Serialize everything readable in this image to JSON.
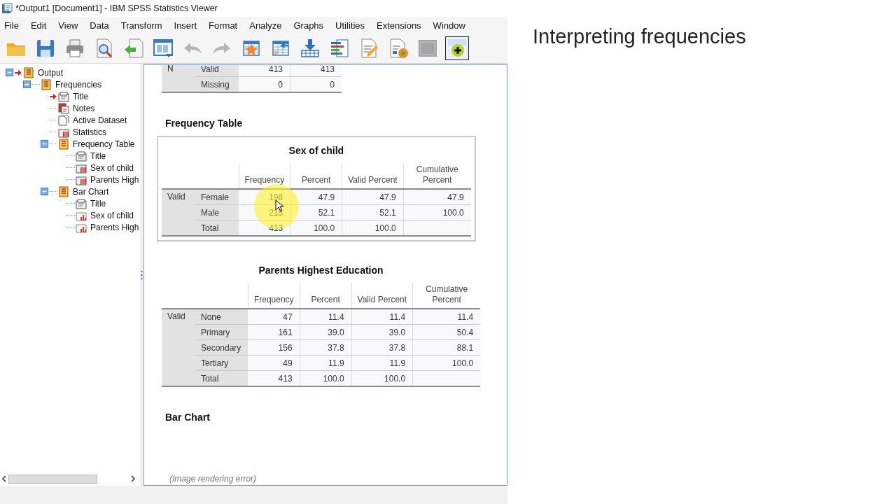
{
  "window": {
    "title": "*Output1 [Document1] - IBM SPSS Statistics Viewer"
  },
  "menu": [
    "File",
    "Edit",
    "View",
    "Data",
    "Transform",
    "Insert",
    "Format",
    "Analyze",
    "Graphs",
    "Utilities",
    "Extensions",
    "Window"
  ],
  "toolbar": [
    {
      "kind": "folder",
      "disabled": false,
      "pressed": false
    },
    {
      "kind": "floppy",
      "disabled": false,
      "pressed": false
    },
    {
      "kind": "printer",
      "disabled": false,
      "pressed": false
    },
    {
      "kind": "preview",
      "disabled": false,
      "pressed": false
    },
    {
      "kind": "export",
      "disabled": false,
      "pressed": false
    },
    {
      "kind": "dialog",
      "disabled": false,
      "pressed": false
    },
    {
      "kind": "undo",
      "disabled": true,
      "pressed": false
    },
    {
      "kind": "redo",
      "disabled": true,
      "pressed": false
    },
    {
      "kind": "table-star",
      "disabled": false,
      "pressed": false
    },
    {
      "kind": "table-arrow",
      "disabled": false,
      "pressed": false
    },
    {
      "kind": "download",
      "disabled": false,
      "pressed": false
    },
    {
      "kind": "bars",
      "disabled": false,
      "pressed": false
    },
    {
      "kind": "doc-pencil",
      "disabled": false,
      "pressed": false
    },
    {
      "kind": "doc-play",
      "disabled": false,
      "pressed": false
    },
    {
      "kind": "panel",
      "disabled": true,
      "pressed": false
    },
    {
      "kind": "plus",
      "disabled": false,
      "pressed": true
    }
  ],
  "outline": [
    {
      "label": "Output",
      "kind": "folder",
      "expanded": true,
      "current": true,
      "children": [
        {
          "label": "Frequencies",
          "kind": "folder",
          "expanded": true,
          "current": false,
          "children": [
            {
              "label": "Title",
              "kind": "title",
              "current": true
            },
            {
              "label": "Notes",
              "kind": "notes",
              "current": false
            },
            {
              "label": "Active Dataset",
              "kind": "dataset",
              "current": false
            },
            {
              "label": "Statistics",
              "kind": "table",
              "current": false
            },
            {
              "label": "Frequency Table",
              "kind": "folder",
              "expanded": true,
              "current": false,
              "children": [
                {
                  "label": "Title",
                  "kind": "title",
                  "current": false
                },
                {
                  "label": "Sex of child",
                  "kind": "table",
                  "current": false
                },
                {
                  "label": "Parents High",
                  "kind": "table",
                  "current": false
                }
              ]
            },
            {
              "label": "Bar Chart",
              "kind": "folder",
              "expanded": true,
              "current": false,
              "children": [
                {
                  "label": "Title",
                  "kind": "title",
                  "current": false
                },
                {
                  "label": "Sex of child",
                  "kind": "chart",
                  "current": false
                },
                {
                  "label": "Parents High",
                  "kind": "chart",
                  "current": false
                }
              ]
            }
          ]
        }
      ]
    }
  ],
  "viewer": {
    "items": [
      {
        "kind": "table",
        "selected": false,
        "highlight": false,
        "rows": [
          {
            "group": "N",
            "label": "Valid",
            "cells": [
              "413",
              "413"
            ]
          },
          {
            "label": "Missing",
            "cells": [
              "0",
              "0"
            ]
          }
        ]
      },
      {
        "kind": "heading",
        "text": "Frequency Table"
      },
      {
        "kind": "table",
        "selected": true,
        "highlight": true,
        "title": "Sex of child",
        "columns": [
          "Frequency",
          "Percent",
          "Valid Percent",
          "Cumulative Percent"
        ],
        "rows": [
          {
            "group": "Valid",
            "label": "Female",
            "cells": [
              "198",
              "47.9",
              "47.9",
              "47.9"
            ]
          },
          {
            "label": "Male",
            "cells": [
              "215",
              "52.1",
              "52.1",
              "100.0"
            ]
          },
          {
            "label": "Total",
            "cells": [
              "413",
              "100.0",
              "100.0"
            ]
          }
        ]
      },
      {
        "kind": "table",
        "selected": false,
        "highlight": false,
        "title": "Parents Highest Education",
        "columns": [
          "Frequency",
          "Percent",
          "Valid Percent",
          "Cumulative Percent"
        ],
        "rows": [
          {
            "group": "Valid",
            "label": "None",
            "cells": [
              "47",
              "11.4",
              "11.4",
              "11.4"
            ]
          },
          {
            "label": "Primary",
            "cells": [
              "161",
              "39.0",
              "39.0",
              "50.4"
            ]
          },
          {
            "label": "Secondary",
            "cells": [
              "156",
              "37.8",
              "37.8",
              "88.1"
            ]
          },
          {
            "label": "Tertiary",
            "cells": [
              "49",
              "11.9",
              "11.9",
              "100.0"
            ]
          },
          {
            "label": "Total",
            "cells": [
              "413",
              "100.0",
              "100.0"
            ]
          }
        ]
      },
      {
        "kind": "heading",
        "text": "Bar Chart"
      },
      {
        "kind": "error",
        "text": "(Image rendering error)"
      }
    ]
  },
  "slide": {
    "heading": "Interpreting frequencies"
  }
}
